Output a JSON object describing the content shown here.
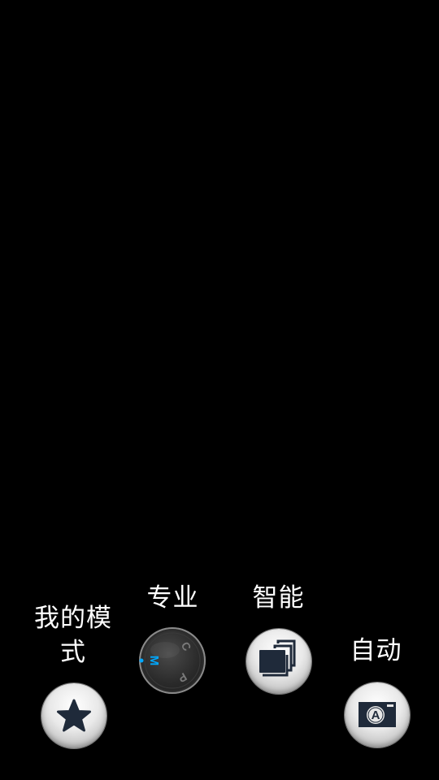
{
  "modes": {
    "my_mode": {
      "label": "我的模式",
      "icon": "star-icon"
    },
    "pro": {
      "label": "专业",
      "icon": "mode-dial-icon",
      "dial": {
        "m": "M",
        "c": "C",
        "p": "P"
      }
    },
    "smart": {
      "label": "智能",
      "icon": "layered-frames-icon"
    },
    "auto": {
      "label": "自动",
      "icon": "auto-camera-icon",
      "badge": "A"
    }
  },
  "colors": {
    "background": "#000000",
    "dial_accent": "#00a8ff",
    "icon_dark": "#1f2a3a"
  }
}
